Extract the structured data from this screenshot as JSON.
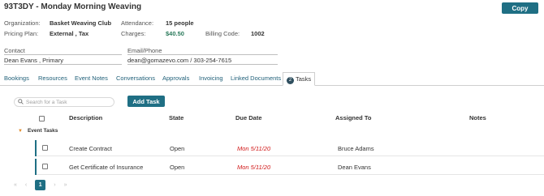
{
  "header": {
    "title": "93T3DY - Monday Morning Weaving",
    "copy_label": "Copy"
  },
  "details": {
    "organization_label": "Organization:",
    "organization_value": "Basket Weaving Club",
    "pricing_label": "Pricing Plan:",
    "pricing_value": "External , Tax",
    "attendance_label": "Attendance:",
    "attendance_value": "15 people",
    "charges_label": "Charges:",
    "charges_value": "$40.50",
    "billing_label": "Billing Code:",
    "billing_value": "1002",
    "contact_label": "Contact",
    "contact_value": "Dean Evans , Primary",
    "email_label": "Email/Phone",
    "email_value": "dean@gomazevo.com / 303-254-7615"
  },
  "tabs": [
    {
      "label": "Bookings"
    },
    {
      "label": "Resources"
    },
    {
      "label": "Event Notes"
    },
    {
      "label": "Conversations"
    },
    {
      "label": "Approvals"
    },
    {
      "label": "Invoicing"
    },
    {
      "label": "Linked Documents"
    },
    {
      "label": "Tasks",
      "badge": "2",
      "active": true
    }
  ],
  "toolbar": {
    "search_placeholder": "Search for a Task",
    "add_label": "Add Task"
  },
  "table": {
    "columns": [
      "Description",
      "State",
      "Due Date",
      "Assigned To",
      "Notes"
    ],
    "group_label": "Event Tasks",
    "rows": [
      {
        "description": "Create Contract",
        "state": "Open",
        "due": "Mon 5/11/20",
        "assigned": "Bruce Adams",
        "notes": ""
      },
      {
        "description": "Get Certificate of Insurance",
        "state": "Open",
        "due": "Mon 5/11/20",
        "assigned": "Dean Evans",
        "notes": ""
      }
    ]
  },
  "pager": {
    "first": "«",
    "prev": "‹",
    "current": "1",
    "next": "›",
    "last": "»"
  },
  "colors": {
    "accent": "#1f6f84",
    "due_date": "#d11a1a",
    "charges": "#2b7a5b",
    "group_arrow": "#e08a2a"
  }
}
